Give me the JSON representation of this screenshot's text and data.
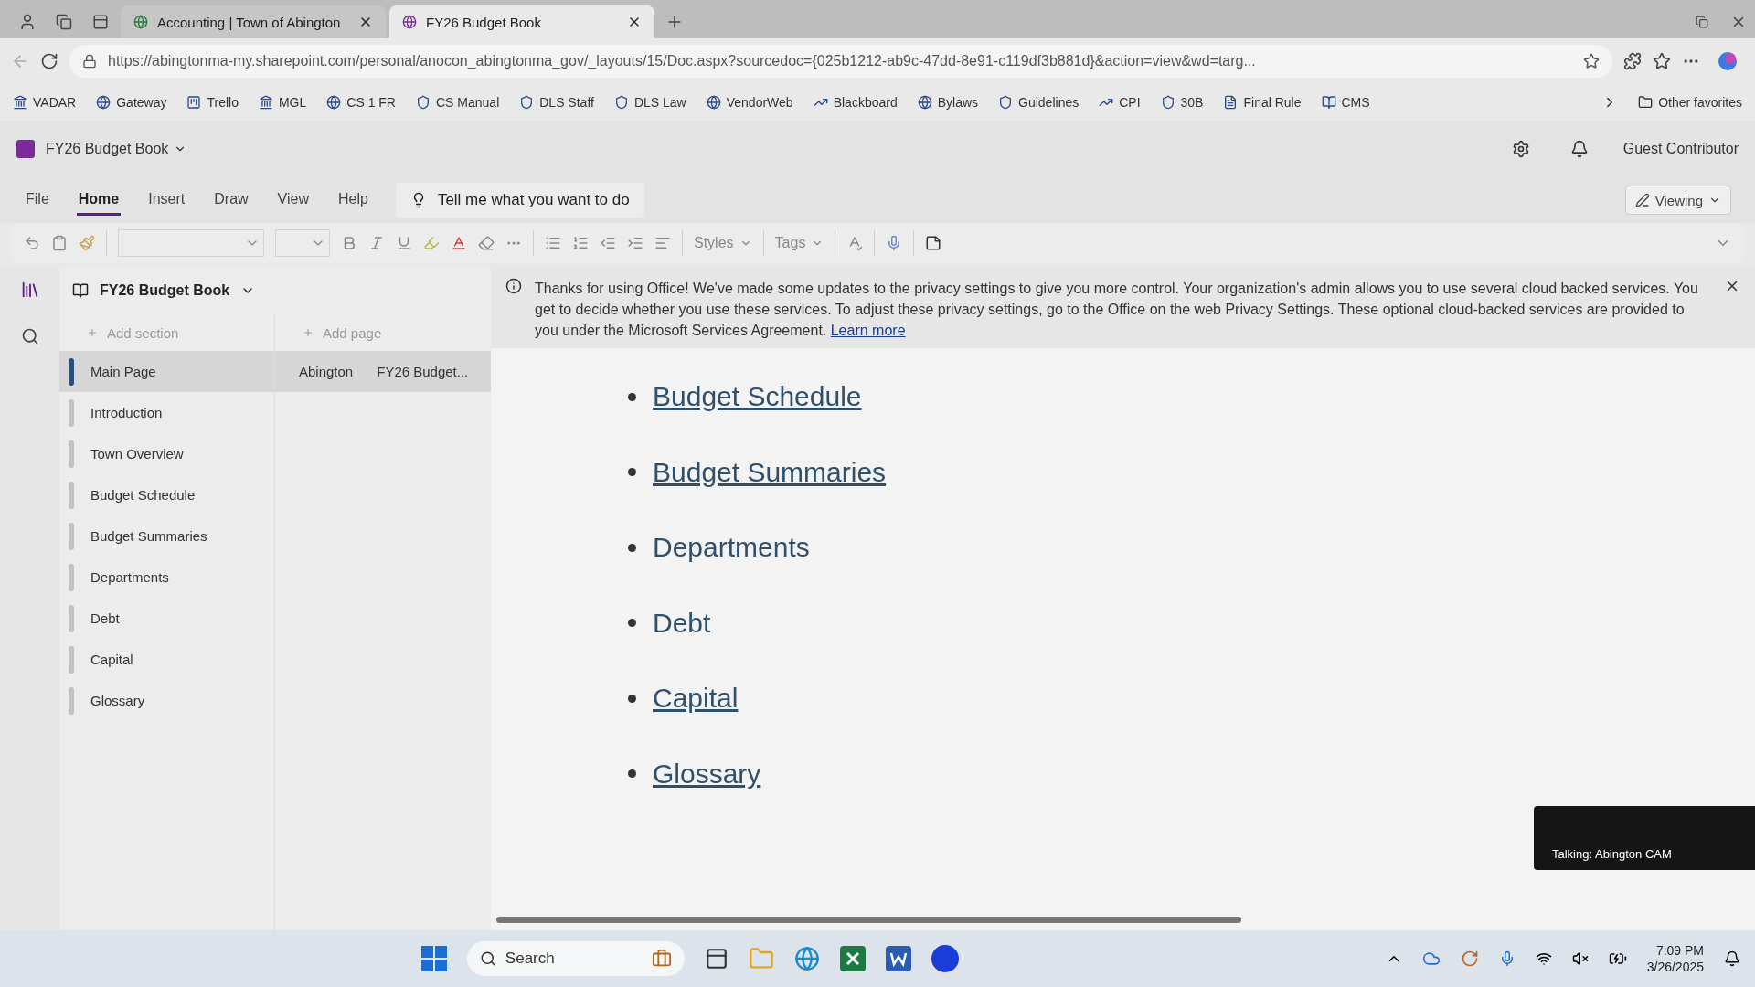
{
  "browser": {
    "tabs": [
      {
        "title": "Accounting | Town of Abington",
        "selected": false
      },
      {
        "title": "FY26 Budget Book",
        "selected": true
      }
    ],
    "url": "https://abingtonma-my.sharepoint.com/personal/anocon_abingtonma_gov/_layouts/15/Doc.aspx?sourcedoc={025b1212-ab9c-47dd-8e91-c119df3b881d}&action=view&wd=targ...",
    "favorites": [
      "VADAR",
      "Gateway",
      "Trello",
      "MGL",
      "CS 1 FR",
      "CS Manual",
      "DLS Staff",
      "DLS Law",
      "VendorWeb",
      "Blackboard",
      "Bylaws",
      "Guidelines",
      "CPI",
      "30B",
      "Final Rule",
      "CMS"
    ],
    "other_favorites": "Other favorites"
  },
  "app": {
    "title": "FY26 Budget Book",
    "user": "Guest Contributor",
    "mode": "Viewing",
    "ribbon_tabs": [
      {
        "label": "File",
        "selected": false
      },
      {
        "label": "Home",
        "selected": true
      },
      {
        "label": "Insert",
        "selected": false
      },
      {
        "label": "Draw",
        "selected": false
      },
      {
        "label": "View",
        "selected": false
      },
      {
        "label": "Help",
        "selected": false
      }
    ],
    "tell_me": "Tell me what you want to do",
    "styles": "Styles",
    "tags": "Tags"
  },
  "notebook": {
    "name": "FY26 Budget Book",
    "add_section": "Add section",
    "add_page": "Add page",
    "sections": [
      {
        "name": "Main Page",
        "selected": true
      },
      {
        "name": "Introduction",
        "selected": false
      },
      {
        "name": "Town Overview",
        "selected": false
      },
      {
        "name": "Budget Schedule",
        "selected": false
      },
      {
        "name": "Budget Summaries",
        "selected": false
      },
      {
        "name": "Departments",
        "selected": false
      },
      {
        "name": "Debt",
        "selected": false
      },
      {
        "name": "Capital",
        "selected": false
      },
      {
        "name": "Glossary",
        "selected": false
      }
    ],
    "pages": [
      {
        "label": "Abington",
        "detail": "FY26 Budget...",
        "selected": true
      }
    ]
  },
  "banner": {
    "text": "Thanks for using Office! We've made some updates to the privacy settings to give you more control. Your organization's admin allows you to use several cloud backed services. You get to decide whether you use these services. To adjust these privacy settings, go to the Office on the web Privacy Settings. These optional cloud-backed services are provided to you under the Microsoft Services Agreement.",
    "link": "Learn more"
  },
  "content": {
    "items": [
      {
        "text": "Budget Schedule",
        "linked": true
      },
      {
        "text": "Budget Summaries",
        "linked": true
      },
      {
        "text": "Departments",
        "linked": false
      },
      {
        "text": "Debt",
        "linked": false
      },
      {
        "text": "Capital",
        "linked": true
      },
      {
        "text": "Glossary",
        "linked": true
      }
    ]
  },
  "call_widget": {
    "status": "Talking: Abington CAM"
  },
  "taskbar": {
    "search": "Search",
    "time": "7:09 PM",
    "date": "3/26/2025"
  }
}
